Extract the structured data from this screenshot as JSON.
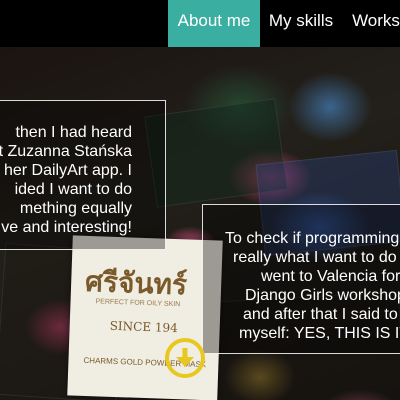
{
  "nav": {
    "items": [
      {
        "label": "About me",
        "active": true
      },
      {
        "label": "My skills",
        "active": false
      },
      {
        "label": "Works",
        "active": false
      }
    ],
    "active_color": "#3aaea0"
  },
  "panel_left": {
    "lines": [
      "then I had heard",
      "t Zuzanna Stańska",
      "her DailyArt app. I",
      "ided I want to do",
      "mething equally",
      "ve and interesting!"
    ]
  },
  "panel_right": {
    "lines": [
      "To check if programming",
      "really what I want to do",
      "went to Valencia for",
      "Django Girls workshop",
      "and after that I said to",
      "myself: YES, THIS IS IT"
    ]
  },
  "background_label": {
    "thai": "ศรีจันทร์",
    "tagline": "PERFECT FOR OILY SKIN",
    "since": "SINCE 194",
    "bottom": "CHARMS GOLD POWDER MASK"
  },
  "scroll_button": {
    "icon": "arrow-down-icon",
    "color": "#e8c71e"
  }
}
